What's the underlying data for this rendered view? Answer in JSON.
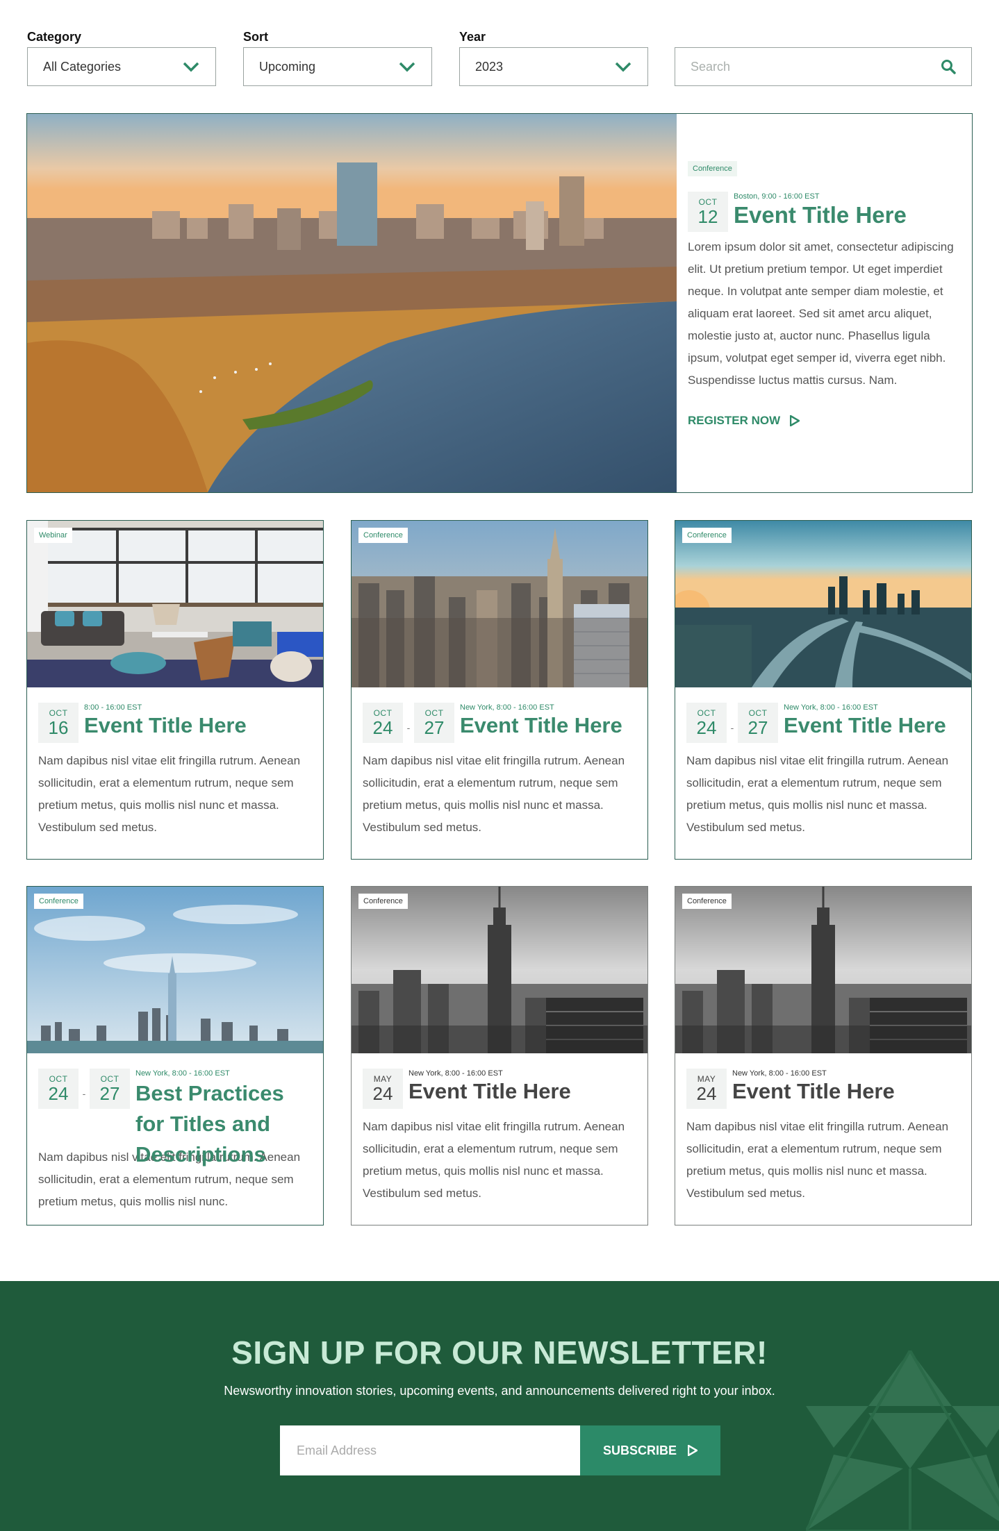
{
  "filters": {
    "category": {
      "label": "Category",
      "value": "All Categories"
    },
    "sort": {
      "label": "Sort",
      "value": "Upcoming"
    },
    "year": {
      "label": "Year",
      "value": "2023"
    },
    "search": {
      "placeholder": "Search"
    }
  },
  "featured": {
    "tag": "Conference",
    "month": "OCT",
    "day": "12",
    "meta": "Boston, 9:00 - 16:00 EST",
    "title": "Event Title Here",
    "description": "Lorem ipsum dolor sit amet, consectetur adipiscing elit. Ut pretium pretium tempor. Ut eget imperdiet neque. In volutpat ante semper diam molestie, et aliquam erat laoreet. Sed sit amet arcu aliquet, molestie justo at, auctor nunc. Phasellus ligula ipsum, volutpat eget semper id, viverra eget nibh. Suspendisse luctus mattis cursus. Nam.",
    "cta": "REGISTER NOW"
  },
  "cards": [
    {
      "tag": "Webinar",
      "month1": "OCT",
      "day1": "16",
      "meta": "8:00 - 16:00 EST",
      "title": "Event Title Here",
      "description": "Nam dapibus nisl vitae elit fringilla rutrum. Aenean sollicitudin, erat a elementum rutrum, neque sem pretium metus, quis mollis nisl nunc et massa. Vestibulum sed metus."
    },
    {
      "tag": "Conference",
      "month1": "OCT",
      "day1": "24",
      "sep": "-",
      "month2": "OCT",
      "day2": "27",
      "meta": "New York, 8:00 - 16:00 EST",
      "title": "Event Title Here",
      "description": "Nam dapibus nisl vitae elit fringilla rutrum. Aenean sollicitudin, erat a elementum rutrum, neque sem pretium metus, quis mollis nisl nunc et massa. Vestibulum sed metus."
    },
    {
      "tag": "Conference",
      "month1": "OCT",
      "day1": "24",
      "sep": "-",
      "month2": "OCT",
      "day2": "27",
      "meta": "New York, 8:00 - 16:00 EST",
      "title": "Event Title Here",
      "description": "Nam dapibus nisl vitae elit fringilla rutrum. Aenean sollicitudin, erat a elementum rutrum, neque sem pretium metus, quis mollis nisl nunc et massa. Vestibulum sed metus."
    },
    {
      "tag": "Conference",
      "month1": "OCT",
      "day1": "24",
      "sep": "-",
      "month2": "OCT",
      "day2": "27",
      "meta": "New York, 8:00 - 16:00 EST",
      "title": "Best Practices for Titles and Descriptions",
      "description": "Nam dapibus nisl vitae elit fringilla rutrum. Aenean sollicitudin, erat a elementum rutrum, neque sem pretium metus, quis mollis nisl nunc."
    },
    {
      "tag": "Conference",
      "month1": "MAY",
      "day1": "24",
      "meta": "New York, 8:00 - 16:00 EST",
      "title": "Event Title Here",
      "description": "Nam dapibus nisl vitae elit fringilla rutrum. Aenean sollicitudin, erat a elementum rutrum, neque sem pretium metus, quis mollis nisl nunc et massa. Vestibulum sed metus."
    },
    {
      "tag": "Conference",
      "month1": "MAY",
      "day1": "24",
      "meta": "New York, 8:00 - 16:00 EST",
      "title": "Event Title Here",
      "description": "Nam dapibus nisl vitae elit fringilla rutrum. Aenean sollicitudin, erat a elementum rutrum, neque sem pretium metus, quis mollis nisl nunc et massa. Vestibulum sed metus."
    }
  ],
  "newsletter": {
    "title": "SIGN UP FOR OUR NEWSLETTER!",
    "subtitle": "Newsworthy innovation stories, upcoming events, and announcements delivered right to your inbox.",
    "input_placeholder": "Email Address",
    "button": "SUBSCRIBE"
  },
  "colors": {
    "accent": "#2e8a68",
    "border": "#2b5e52",
    "newsletter_bg": "#1f5b3b",
    "newsletter_title": "#c8ead6"
  },
  "icons": [
    "chevron-down-icon",
    "search-icon",
    "play-arrow-icon",
    "triangle-pattern-icon"
  ]
}
